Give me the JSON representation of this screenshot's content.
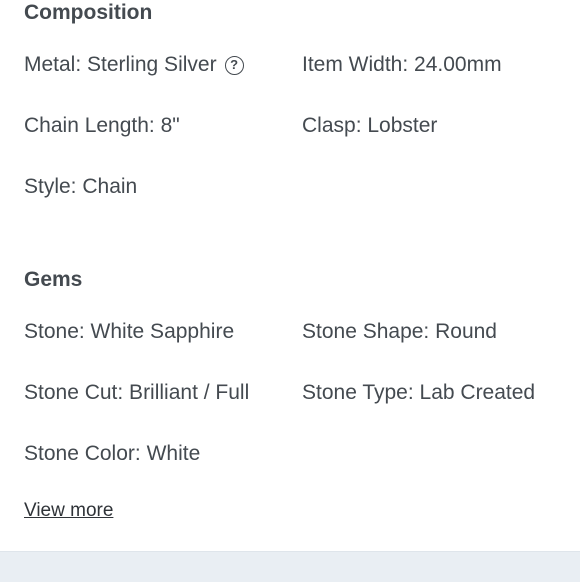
{
  "composition": {
    "title": "Composition",
    "items": [
      {
        "label": "Metal: Sterling Silver"
      },
      {
        "label": "Item Width: 24.00mm"
      },
      {
        "label": "Chain Length: 8\""
      },
      {
        "label": "Clasp: Lobster"
      },
      {
        "label": "Style: Chain"
      }
    ],
    "help_icon_glyph": "?"
  },
  "gems": {
    "title": "Gems",
    "items": [
      {
        "label": "Stone: White Sapphire"
      },
      {
        "label": "Stone Shape: Round"
      },
      {
        "label": "Stone Cut: Brilliant / Full"
      },
      {
        "label": "Stone Type: Lab Created"
      },
      {
        "label": "Stone Color: White"
      }
    ]
  },
  "view_more_label": "View more",
  "colors": {
    "text": "#444a50",
    "panel": "#e9eef3"
  }
}
